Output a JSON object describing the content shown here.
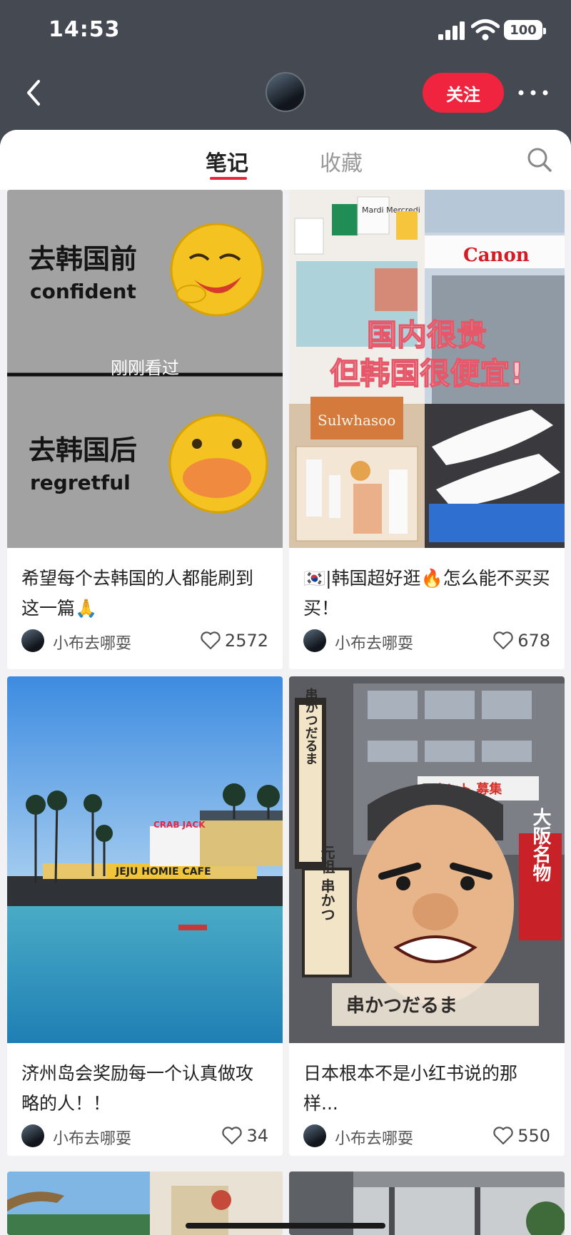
{
  "status_bar": {
    "time": "14:53",
    "battery": "100"
  },
  "nav": {
    "follow_label": "关注"
  },
  "tabs": [
    {
      "label": "笔记",
      "active": true
    },
    {
      "label": "收藏",
      "active": false
    }
  ],
  "notes": [
    {
      "title": "希望每个去韩国的人都能刷到这一篇🙏",
      "author": "小布去哪耍",
      "likes": "2572",
      "seen_label": "刚刚看过",
      "image_text": {
        "before_cn": "去韩国前",
        "before_en": "confident",
        "after_cn": "去韩国后",
        "after_en": "regretful"
      }
    },
    {
      "title": "🇰🇷|韩国超好逛🔥怎么能不买买买！",
      "author": "小布去哪耍",
      "likes": "678",
      "image_text": {
        "line1": "国内很贵",
        "line2": "但韩国很便宜!",
        "brand": "Canon",
        "brand2": "Sulwhasoo",
        "shop": "Mardi Mercredi"
      }
    },
    {
      "title": "济州岛会奖励每一个认真做攻略的人！！",
      "author": "小布去哪耍",
      "likes": "34",
      "image_text": {
        "sign": "JEJU HOMIE CAFE",
        "sign2": "CRAB JACK"
      }
    },
    {
      "title": "日本根本不是小红书说的那样...",
      "author": "小布去哪耍",
      "likes": "550",
      "image_text": {
        "sign_left": "元祖 串かつ",
        "sign_right": "大阪名物",
        "sign_vertical": "串かつだるま",
        "sign_bottom": "串かつだるま",
        "sign_red": "テナント 募集"
      }
    }
  ],
  "colors": {
    "accent": "#f0243e",
    "header_bg": "#454a52"
  }
}
